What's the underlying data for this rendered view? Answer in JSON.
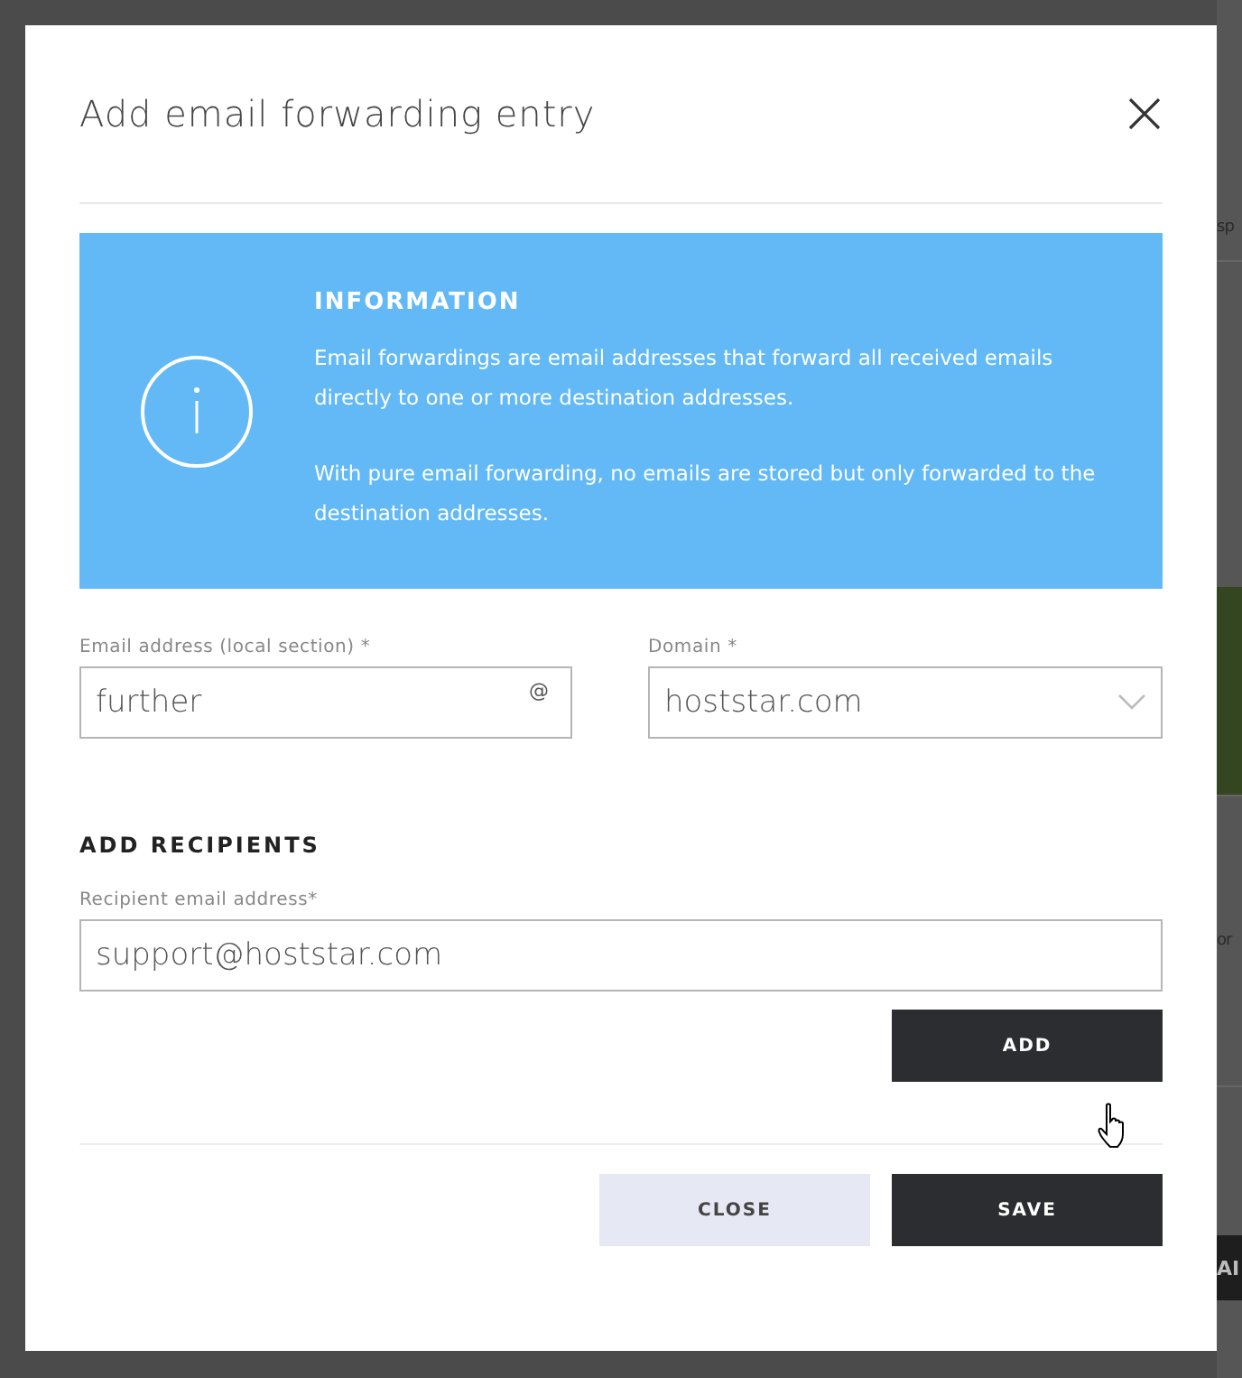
{
  "background": {
    "fragments": [
      {
        "kind": "text",
        "text": "sp"
      },
      {
        "kind": "block",
        "color": "#34461f"
      },
      {
        "kind": "text",
        "text": "or"
      },
      {
        "kind": "button",
        "text": "AI"
      }
    ]
  },
  "dialog": {
    "title": "Add email forwarding entry",
    "info": {
      "heading": "INFORMATION",
      "paragraphs": [
        "Email forwardings are email addresses that forward all received emails directly to one or more destination addresses.",
        "With pure email forwarding, no emails are stored but only forwarded to the destination addresses."
      ]
    },
    "local_field": {
      "label": "Email address (local section) *",
      "value": "further",
      "suffix": "@"
    },
    "domain_field": {
      "label": "Domain *",
      "value": "hoststar.com"
    },
    "recipients": {
      "heading": "ADD RECIPIENTS",
      "field": {
        "label": "Recipient email address*",
        "value": "support@hoststar.com"
      },
      "add_button": "ADD"
    },
    "buttons": [
      {
        "label": "CLOSE",
        "kind": "secondary"
      },
      {
        "label": "SAVE",
        "kind": "primary"
      }
    ]
  }
}
